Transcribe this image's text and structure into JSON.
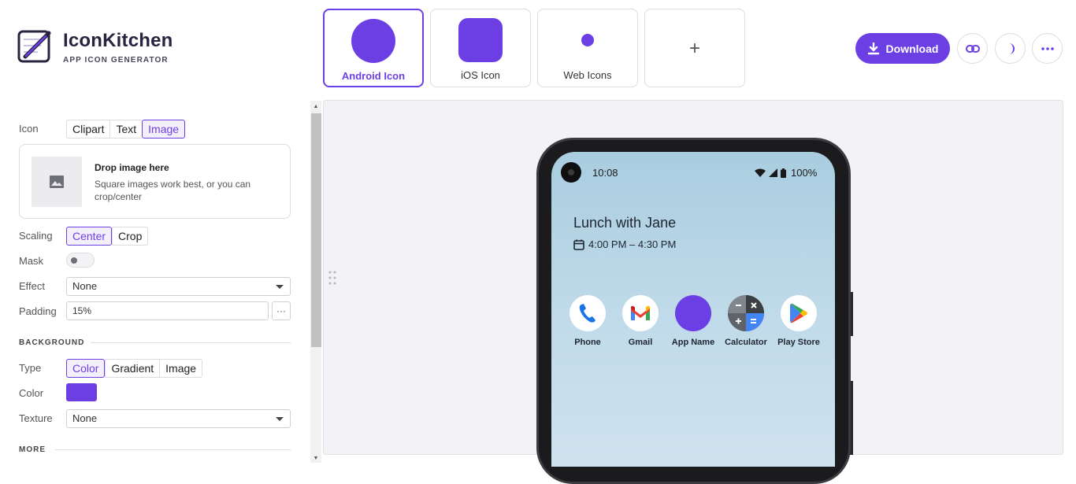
{
  "brand": {
    "title": "IconKitchen",
    "subtitle": "APP ICON GENERATOR"
  },
  "targets": [
    {
      "label": "Android Icon",
      "active": true
    },
    {
      "label": "iOS Icon",
      "active": false
    },
    {
      "label": "Web Icons",
      "active": false
    },
    {
      "label": "+",
      "active": false
    }
  ],
  "toolbar": {
    "download_label": "Download",
    "link_icon": "link-icon",
    "theme_icon": "moon-icon",
    "more_icon": "more-dots-icon"
  },
  "accent": "#6c3fe4",
  "panel": {
    "icon_label": "Icon",
    "icon_options": [
      "Clipart",
      "Text",
      "Image"
    ],
    "icon_selected": "Image",
    "drop_title": "Drop image here",
    "drop_desc": "Square images work best, or you can crop/center",
    "scaling_label": "Scaling",
    "scaling_options": [
      "Center",
      "Crop"
    ],
    "mask_label": "Mask",
    "effect_label": "Effect",
    "effect_value": "None",
    "padding_label": "Padding",
    "padding_value": "15%",
    "padding_more": "···",
    "background_heading": "BACKGROUND",
    "type_label": "Type",
    "type_options": [
      "Color",
      "Gradient",
      "Image"
    ],
    "color_label": "Color",
    "color_value": "#6c3fe4",
    "texture_label": "Texture",
    "texture_value": "None",
    "more_heading": "MORE"
  },
  "phone": {
    "time": "10:08",
    "battery": "100%",
    "event_title": "Lunch with Jane",
    "event_time": "4:00 PM – 4:30 PM",
    "apps": [
      {
        "name": "Phone",
        "icon": "phone-icon"
      },
      {
        "name": "Gmail",
        "icon": "gmail-icon"
      },
      {
        "name": "App Name",
        "icon": "app-preview-icon"
      },
      {
        "name": "Calculator",
        "icon": "calculator-icon"
      },
      {
        "name": "Play Store",
        "icon": "play-store-icon"
      }
    ]
  }
}
